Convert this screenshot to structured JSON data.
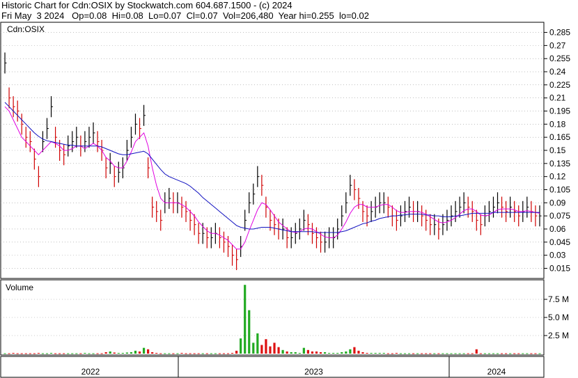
{
  "header": {
    "line1": "Historic Chart for Cdn:OSIX by Stockwatch.com 604.687.1500 - (c) 2024",
    "line2": "Fri May  3 2024   Op=0.08  Hi=0.08  Lo=0.07  Cl=0.07  Vol=206,480  Year hi=0.255  lo=0.02"
  },
  "price_panel": {
    "label": "Cdn:OSIX"
  },
  "volume_panel": {
    "label": "Volume"
  },
  "colors": {
    "up": "#000000",
    "down": "#d00000",
    "ma_short": "#e000e0",
    "ma_long": "#1010c0",
    "vol_up": "#22aa22",
    "vol_down": "#dd1111",
    "grid": "#999999"
  },
  "chart_data": {
    "type": "line",
    "y_ticks": [
      "0.285",
      "0.27",
      "0.255",
      "0.24",
      "0.225",
      "0.21",
      "0.195",
      "0.18",
      "0.165",
      "0.15",
      "0.135",
      "0.12",
      "0.105",
      "0.09",
      "0.075",
      "0.06",
      "0.045",
      "0.03",
      "0.015"
    ],
    "ylim": [
      0.005,
      0.295
    ],
    "x_ticks": [
      "2022",
      "2023",
      "2024"
    ],
    "volume_ticks": [
      "7.5 M",
      "5.0 M",
      "2.5 M"
    ],
    "volume_ylim": [
      0,
      10
    ],
    "series": [
      {
        "values": [
          0.25,
          0.21,
          0.2,
          0.195,
          0.18,
          0.165,
          0.16,
          0.14,
          0.12,
          0.16,
          0.175,
          0.2,
          0.165,
          0.15,
          0.145,
          0.155,
          0.16,
          0.165,
          0.155,
          0.16,
          0.165,
          0.17,
          0.16,
          0.15,
          0.13,
          0.135,
          0.12,
          0.125,
          0.13,
          0.15,
          0.165,
          0.18,
          0.175,
          0.19,
          0.13,
          0.085,
          0.08,
          0.07,
          0.09,
          0.095,
          0.09,
          0.09,
          0.085,
          0.08,
          0.07,
          0.065,
          0.055,
          0.055,
          0.05,
          0.05,
          0.055,
          0.05,
          0.045,
          0.04,
          0.03,
          0.025,
          0.04,
          0.07,
          0.09,
          0.1,
          0.12,
          0.11,
          0.085,
          0.07,
          0.065,
          0.06,
          0.06,
          0.05,
          0.05,
          0.055,
          0.06,
          0.07,
          0.065,
          0.055,
          0.05,
          0.045,
          0.045,
          0.05,
          0.05,
          0.06,
          0.075,
          0.09,
          0.11,
          0.105,
          0.095,
          0.08,
          0.075,
          0.08,
          0.085,
          0.09,
          0.09,
          0.085,
          0.075,
          0.07,
          0.075,
          0.08,
          0.085,
          0.08,
          0.08,
          0.075,
          0.07,
          0.065,
          0.065,
          0.06,
          0.065,
          0.07,
          0.075,
          0.08,
          0.085,
          0.09,
          0.085,
          0.08,
          0.07,
          0.065,
          0.075,
          0.08,
          0.085,
          0.09,
          0.085,
          0.08,
          0.085,
          0.08,
          0.075,
          0.08,
          0.085,
          0.08,
          0.075,
          0.075
        ]
      },
      {
        "values": [
          0.2,
          0.195,
          0.185,
          0.175,
          0.165,
          0.16,
          0.155,
          0.15,
          0.145,
          0.15,
          0.155,
          0.16,
          0.158,
          0.155,
          0.15,
          0.15,
          0.152,
          0.155,
          0.155,
          0.152,
          0.155,
          0.158,
          0.155,
          0.15,
          0.142,
          0.138,
          0.132,
          0.13,
          0.13,
          0.138,
          0.148,
          0.16,
          0.165,
          0.17,
          0.155,
          0.13,
          0.11,
          0.095,
          0.09,
          0.09,
          0.09,
          0.09,
          0.088,
          0.085,
          0.08,
          0.075,
          0.068,
          0.063,
          0.058,
          0.055,
          0.055,
          0.053,
          0.05,
          0.047,
          0.042,
          0.037,
          0.037,
          0.045,
          0.058,
          0.07,
          0.082,
          0.09,
          0.088,
          0.082,
          0.075,
          0.068,
          0.064,
          0.06,
          0.057,
          0.056,
          0.057,
          0.06,
          0.061,
          0.06,
          0.057,
          0.054,
          0.051,
          0.05,
          0.05,
          0.053,
          0.06,
          0.068,
          0.078,
          0.085,
          0.088,
          0.088,
          0.085,
          0.085,
          0.085,
          0.087,
          0.088,
          0.088,
          0.085,
          0.081,
          0.079,
          0.079,
          0.08,
          0.08,
          0.08,
          0.079,
          0.077,
          0.074,
          0.071,
          0.068,
          0.067,
          0.068,
          0.07,
          0.073,
          0.077,
          0.081,
          0.083,
          0.083,
          0.08,
          0.076,
          0.075,
          0.076,
          0.079,
          0.082,
          0.083,
          0.083,
          0.083,
          0.082,
          0.08,
          0.08,
          0.081,
          0.08,
          0.079,
          0.078
        ]
      },
      {
        "values": [
          0.205,
          0.2,
          0.195,
          0.19,
          0.185,
          0.18,
          0.175,
          0.17,
          0.166,
          0.163,
          0.161,
          0.16,
          0.159,
          0.158,
          0.157,
          0.156,
          0.156,
          0.155,
          0.155,
          0.155,
          0.155,
          0.155,
          0.155,
          0.154,
          0.152,
          0.15,
          0.148,
          0.146,
          0.145,
          0.145,
          0.146,
          0.147,
          0.148,
          0.149,
          0.146,
          0.14,
          0.134,
          0.128,
          0.123,
          0.12,
          0.118,
          0.116,
          0.114,
          0.112,
          0.109,
          0.105,
          0.101,
          0.096,
          0.092,
          0.088,
          0.084,
          0.08,
          0.076,
          0.072,
          0.068,
          0.064,
          0.062,
          0.061,
          0.06,
          0.06,
          0.061,
          0.062,
          0.062,
          0.062,
          0.061,
          0.06,
          0.059,
          0.058,
          0.057,
          0.057,
          0.057,
          0.057,
          0.057,
          0.057,
          0.056,
          0.056,
          0.056,
          0.056,
          0.056,
          0.056,
          0.057,
          0.058,
          0.06,
          0.062,
          0.064,
          0.066,
          0.067,
          0.069,
          0.07,
          0.072,
          0.073,
          0.074,
          0.075,
          0.075,
          0.076,
          0.076,
          0.077,
          0.077,
          0.077,
          0.077,
          0.076,
          0.076,
          0.075,
          0.075,
          0.074,
          0.074,
          0.074,
          0.075,
          0.075,
          0.076,
          0.077,
          0.078,
          0.078,
          0.078,
          0.078,
          0.078,
          0.079,
          0.079,
          0.079,
          0.079,
          0.079,
          0.079,
          0.079,
          0.079,
          0.079,
          0.079,
          0.079,
          0.079
        ]
      }
    ],
    "volume": [
      0.05,
      0.05,
      0.1,
      0.05,
      0.05,
      0.05,
      0.05,
      0.05,
      0.1,
      0.05,
      0.05,
      0.1,
      0.05,
      0.05,
      0.05,
      0.05,
      0.05,
      0.05,
      0.05,
      0.1,
      0.05,
      0.05,
      0.05,
      0.05,
      0.2,
      0.3,
      0.15,
      0.1,
      0.1,
      0.15,
      0.2,
      0.4,
      0.3,
      0.8,
      0.6,
      0.2,
      0.1,
      0.05,
      0.05,
      0.05,
      0.05,
      0.05,
      0.1,
      0.05,
      0.05,
      0.05,
      0.05,
      0.05,
      0.05,
      0.05,
      0.05,
      0.05,
      0.05,
      0.05,
      0.1,
      0.4,
      2.1,
      9.5,
      6.0,
      1.5,
      2.8,
      1.2,
      2.0,
      1.0,
      1.5,
      0.9,
      0.5,
      0.3,
      0.2,
      0.2,
      0.1,
      0.8,
      0.5,
      0.3,
      0.3,
      0.2,
      0.2,
      0.1,
      0.1,
      0.1,
      0.2,
      0.3,
      0.6,
      0.9,
      0.4,
      0.2,
      0.1,
      0.1,
      0.1,
      0.1,
      0.1,
      0.05,
      0.05,
      0.1,
      0.05,
      0.05,
      0.05,
      0.05,
      0.05,
      0.05,
      0.05,
      0.05,
      0.05,
      0.05,
      0.05,
      0.05,
      0.05,
      0.05,
      0.05,
      0.05,
      0.05,
      0.05,
      0.6,
      0.05,
      0.05,
      0.05,
      0.05,
      0.05,
      0.05,
      0.05,
      0.05,
      0.05,
      0.05,
      0.05,
      0.05,
      0.05,
      0.05,
      0.05
    ]
  }
}
